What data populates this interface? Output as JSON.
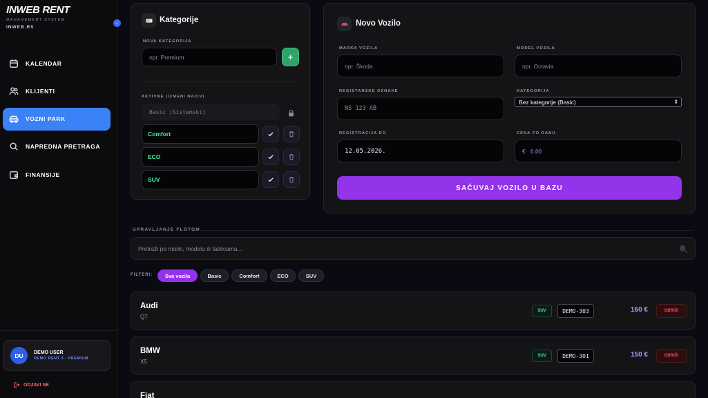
{
  "brand": {
    "title": "INWEB RENT",
    "subtitle": "MANAGEMENT SYSTEM",
    "site": "INWEB.RS"
  },
  "nav": {
    "items": [
      {
        "label": "KALENDAR",
        "icon": "calendar-icon",
        "active": false
      },
      {
        "label": "KLIJENTI",
        "icon": "users-icon",
        "active": false
      },
      {
        "label": "VOZNI PARK",
        "icon": "car-icon",
        "active": true
      },
      {
        "label": "NAPREDNA PRETRAGA",
        "icon": "search-icon",
        "active": false
      },
      {
        "label": "FINANSIJE",
        "icon": "wallet-icon",
        "active": false
      }
    ]
  },
  "user": {
    "initials": "DU",
    "name": "DEMO USER",
    "plan": "DEMO RENT 3 - PREMIUM",
    "logout": "ODJAVI SE"
  },
  "categories_panel": {
    "title": "Kategorije",
    "new_label": "NOVA KATEGORIJA",
    "new_placeholder": "npr. Premium",
    "add_button": "+",
    "active_label": "AKTIVNE (IZMENI NAZIV)",
    "system_category": "Basic (Sistemski)",
    "items": [
      "Comfort",
      "ECO",
      "SUV"
    ]
  },
  "vehicle_form": {
    "title": "Novo Vozilo",
    "make_label": "MARKA VOZILA",
    "make_placeholder": "npr. Škoda",
    "model_label": "MODEL VOZILA",
    "model_placeholder": "npr. Octavia",
    "plates_label": "REGISTARSKE OZNAKE",
    "plates_placeholder": "NS 123 AB",
    "category_label": "KATEGORIJA",
    "category_value": "Bez kategorije (Basic)",
    "registration_label": "REGISTRACIJA DO",
    "registration_value": "12.05.2026.",
    "price_label": "CENA PO DANU",
    "price_currency": "€",
    "price_placeholder": "0.00",
    "submit": "SAČUVAJ VOZILO U BAZU"
  },
  "fleet": {
    "section_label": "UPRAVLJANJE FLOTOM",
    "search_placeholder": "Pretraži po marki, modelu ili tablicama...",
    "filters_label": "FILTERI:",
    "filters": [
      "Sva vozila",
      "Basic",
      "Comfort",
      "ECO",
      "SUV"
    ],
    "active_filter": "Sva vozila",
    "delete_label": "OBRIŠI",
    "cars": [
      {
        "make": "Audi",
        "model": "Q7",
        "category": "SUV",
        "plate": "DEMO-303",
        "price": "160 €"
      },
      {
        "make": "BMW",
        "model": "X5",
        "category": "SUV",
        "plate": "DEMO-301",
        "price": "150 €"
      },
      {
        "make": "Fiat",
        "model": "",
        "category": "",
        "plate": "",
        "price": ""
      }
    ]
  },
  "colors": {
    "accent": "#9333ea",
    "nav_active": "#3b82f6",
    "category_text": "#3ef0a6",
    "danger": "#ff4d5e"
  }
}
